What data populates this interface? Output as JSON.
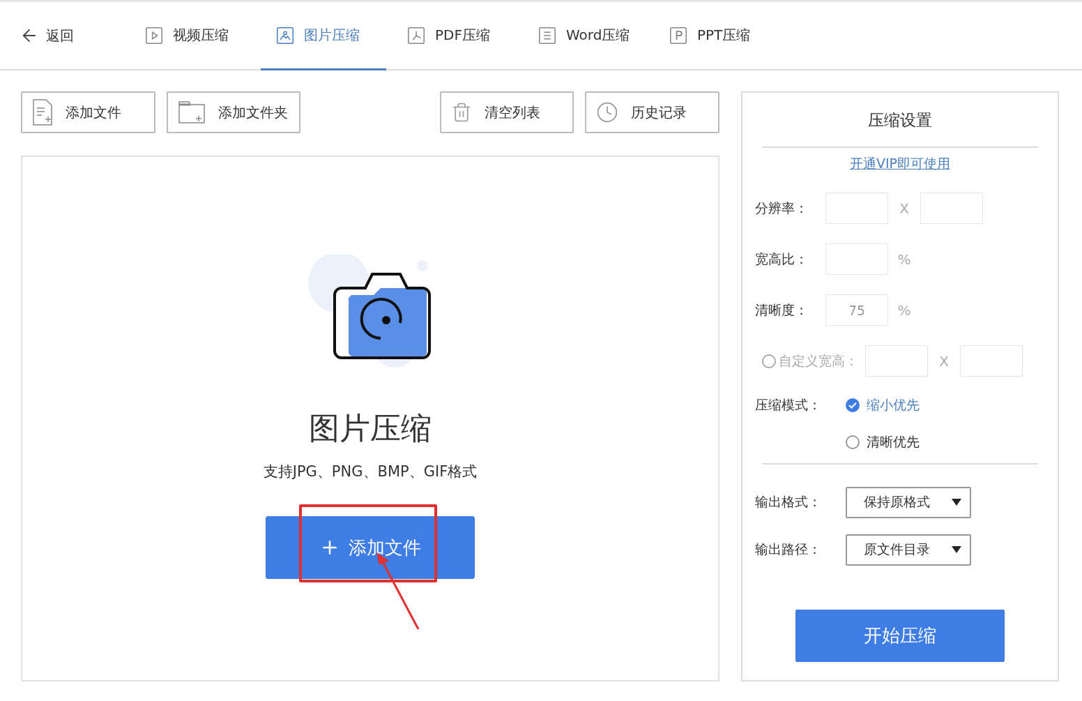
{
  "nav": {
    "back": "返回",
    "tabs": [
      {
        "kind": "video",
        "label": "视频压缩",
        "selected": false
      },
      {
        "kind": "image",
        "label": "图片压缩",
        "selected": true
      },
      {
        "kind": "pdf",
        "label": "PDF压缩",
        "selected": false
      },
      {
        "kind": "word",
        "label": "Word压缩",
        "selected": false
      },
      {
        "kind": "ppt",
        "label": "PPT压缩",
        "selected": false
      }
    ]
  },
  "toolbar": [
    {
      "kind": "file",
      "label": "添加文件"
    },
    {
      "kind": "folder",
      "label": "添加文件夹"
    },
    {
      "kind": "trash",
      "label": "清空列表"
    },
    {
      "kind": "clock",
      "label": "历史记录"
    }
  ],
  "drop_area": {
    "title": "图片压缩",
    "subtitle": "支持JPG、PNG、BMP、GIF格式",
    "button": "添加文件"
  },
  "settings": {
    "title": "压缩设置",
    "vip_link": "开通VIP即可使用",
    "fields": [
      {
        "kind": "pair",
        "label": "分辨率：",
        "separator": "X"
      },
      {
        "kind": "unit",
        "label": "宽高比：",
        "unit": "%"
      },
      {
        "kind": "unit",
        "label": "清晰度：",
        "placeholder": "75",
        "unit": "%"
      },
      {
        "kind": "custom",
        "label": "自定义宽高：",
        "separator": "X",
        "checked": false,
        "disabled": true
      }
    ],
    "mode": {
      "label": "压缩模式：",
      "options": [
        {
          "label": "缩小优先",
          "selected": true
        },
        {
          "label": "清晰优先",
          "selected": false
        }
      ]
    },
    "selects": [
      {
        "label": "输出格式：",
        "value": "保持原格式"
      },
      {
        "label": "输出路径：",
        "value": "原文件目录"
      }
    ],
    "start_button": "开始压缩"
  }
}
